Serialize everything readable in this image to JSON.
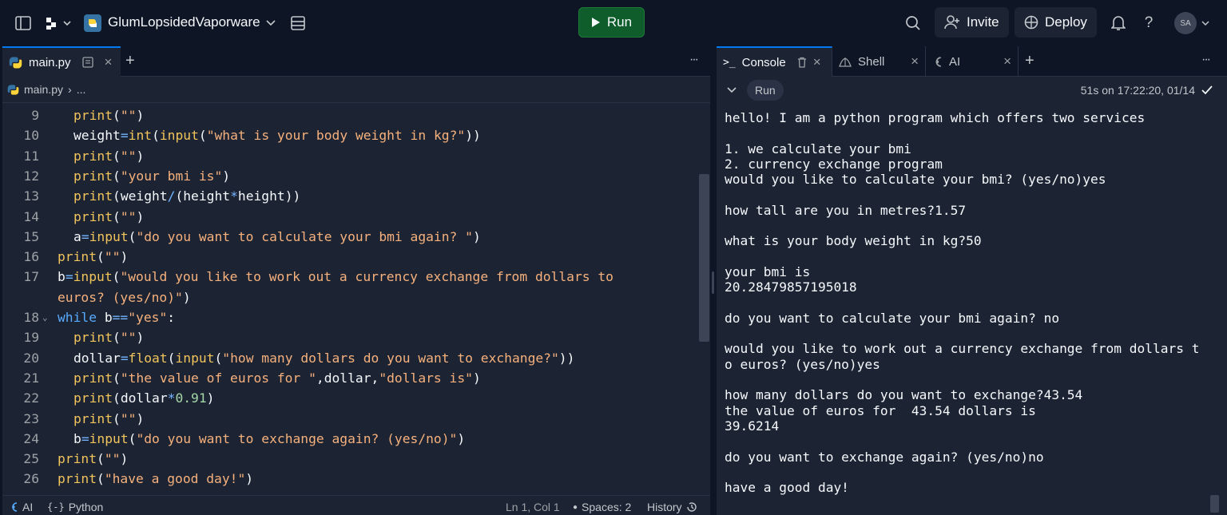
{
  "topbar": {
    "repl_name": "GlumLopsidedVaporware",
    "run_label": "Run",
    "invite_label": "Invite",
    "deploy_label": "Deploy",
    "help_label": "?",
    "avatar_initials": "SA",
    "icons": [
      "sidebar-toggle-icon",
      "workspace-icon",
      "python-icon",
      "chevron-down-icon",
      "database-icon",
      "search-icon",
      "add-user-icon",
      "deploy-icon",
      "bell-icon",
      "help-icon"
    ]
  },
  "editor": {
    "tab_label": "main.py",
    "tab_close": "×",
    "add_tab": "+",
    "more": "···",
    "breadcrumb_file": "main.py",
    "breadcrumb_sep": "›",
    "breadcrumb_more": "...",
    "lines": [
      {
        "n": "9",
        "indent": 1,
        "tokens": [
          [
            "kw",
            "print"
          ],
          [
            "txt",
            "("
          ],
          [
            "str",
            "\"\""
          ],
          [
            "txt",
            ")"
          ]
        ]
      },
      {
        "n": "10",
        "indent": 1,
        "tokens": [
          [
            "txt",
            "weight"
          ],
          [
            "op",
            "="
          ],
          [
            "kw",
            "int"
          ],
          [
            "txt",
            "("
          ],
          [
            "kw",
            "input"
          ],
          [
            "txt",
            "("
          ],
          [
            "str",
            "\"what is your body weight in kg?\""
          ],
          [
            "txt",
            "))"
          ]
        ]
      },
      {
        "n": "11",
        "indent": 1,
        "tokens": [
          [
            "kw",
            "print"
          ],
          [
            "txt",
            "("
          ],
          [
            "str",
            "\"\""
          ],
          [
            "txt",
            ")"
          ]
        ]
      },
      {
        "n": "12",
        "indent": 1,
        "tokens": [
          [
            "kw",
            "print"
          ],
          [
            "txt",
            "("
          ],
          [
            "str",
            "\"your bmi is\""
          ],
          [
            "txt",
            ")"
          ]
        ]
      },
      {
        "n": "13",
        "indent": 1,
        "tokens": [
          [
            "kw",
            "print"
          ],
          [
            "txt",
            "(weight"
          ],
          [
            "op",
            "/"
          ],
          [
            "txt",
            "(height"
          ],
          [
            "op",
            "*"
          ],
          [
            "txt",
            "height))"
          ]
        ]
      },
      {
        "n": "14",
        "indent": 1,
        "tokens": [
          [
            "kw",
            "print"
          ],
          [
            "txt",
            "("
          ],
          [
            "str",
            "\"\""
          ],
          [
            "txt",
            ")"
          ]
        ]
      },
      {
        "n": "15",
        "indent": 1,
        "tokens": [
          [
            "txt",
            "a"
          ],
          [
            "op",
            "="
          ],
          [
            "kw",
            "input"
          ],
          [
            "txt",
            "("
          ],
          [
            "str",
            "\"do you want to calculate your bmi again? \""
          ],
          [
            "txt",
            ")"
          ]
        ]
      },
      {
        "n": "16",
        "indent": 0,
        "tokens": [
          [
            "kw",
            "print"
          ],
          [
            "txt",
            "("
          ],
          [
            "str",
            "\"\""
          ],
          [
            "txt",
            ")"
          ]
        ]
      },
      {
        "n": "17",
        "indent": 0,
        "tokens": [
          [
            "txt",
            "b"
          ],
          [
            "op",
            "="
          ],
          [
            "kw",
            "input"
          ],
          [
            "txt",
            "("
          ],
          [
            "str",
            "\"would you like to work out a currency exchange from dollars to"
          ]
        ]
      },
      {
        "n": "",
        "indent": 0,
        "tokens": [
          [
            "str",
            "euros? (yes/no)\""
          ],
          [
            "txt",
            ")"
          ]
        ]
      },
      {
        "n": "18",
        "indent": 0,
        "fold": true,
        "tokens": [
          [
            "ctl",
            "while"
          ],
          [
            "txt",
            " b"
          ],
          [
            "op",
            "=="
          ],
          [
            "str",
            "\"yes\""
          ],
          [
            "txt",
            ":"
          ]
        ]
      },
      {
        "n": "19",
        "indent": 1,
        "tokens": [
          [
            "kw",
            "print"
          ],
          [
            "txt",
            "("
          ],
          [
            "str",
            "\"\""
          ],
          [
            "txt",
            ")"
          ]
        ]
      },
      {
        "n": "20",
        "indent": 1,
        "tokens": [
          [
            "txt",
            "dollar"
          ],
          [
            "op",
            "="
          ],
          [
            "kw",
            "float"
          ],
          [
            "txt",
            "("
          ],
          [
            "kw",
            "input"
          ],
          [
            "txt",
            "("
          ],
          [
            "str",
            "\"how many dollars do you want to exchange?\""
          ],
          [
            "txt",
            "))"
          ]
        ]
      },
      {
        "n": "21",
        "indent": 1,
        "tokens": [
          [
            "kw",
            "print"
          ],
          [
            "txt",
            "("
          ],
          [
            "str",
            "\"the value of euros for \""
          ],
          [
            "txt",
            ",dollar,"
          ],
          [
            "str",
            "\"dollars is\""
          ],
          [
            "txt",
            ")"
          ]
        ]
      },
      {
        "n": "22",
        "indent": 1,
        "tokens": [
          [
            "kw",
            "print"
          ],
          [
            "txt",
            "(dollar"
          ],
          [
            "op",
            "*"
          ],
          [
            "num",
            "0.91"
          ],
          [
            "txt",
            ")"
          ]
        ]
      },
      {
        "n": "23",
        "indent": 1,
        "tokens": [
          [
            "kw",
            "print"
          ],
          [
            "txt",
            "("
          ],
          [
            "str",
            "\"\""
          ],
          [
            "txt",
            ")"
          ]
        ]
      },
      {
        "n": "24",
        "indent": 1,
        "tokens": [
          [
            "txt",
            "b"
          ],
          [
            "op",
            "="
          ],
          [
            "kw",
            "input"
          ],
          [
            "txt",
            "("
          ],
          [
            "str",
            "\"do you want to exchange again? (yes/no)\""
          ],
          [
            "txt",
            ")"
          ]
        ]
      },
      {
        "n": "25",
        "indent": 0,
        "tokens": [
          [
            "kw",
            "print"
          ],
          [
            "txt",
            "("
          ],
          [
            "str",
            "\"\""
          ],
          [
            "txt",
            ")"
          ]
        ]
      },
      {
        "n": "26",
        "indent": 0,
        "tokens": [
          [
            "kw",
            "print"
          ],
          [
            "txt",
            "("
          ],
          [
            "str",
            "\"have a good day!\""
          ],
          [
            "txt",
            ")"
          ]
        ]
      }
    ],
    "status": {
      "ai": "AI",
      "language": "Python",
      "position": "Ln 1, Col 1",
      "spaces": "Spaces: 2",
      "history": "History"
    }
  },
  "console": {
    "tabs": [
      {
        "label": "Console",
        "icon": "terminal-icon",
        "active": true
      },
      {
        "label": "Shell",
        "icon": "shell-icon",
        "active": false
      },
      {
        "label": "AI",
        "icon": "ai-icon",
        "active": false
      }
    ],
    "add_tab": "+",
    "more": "···",
    "run_chip": "Run",
    "run_meta": "51s on 17:22:20, 01/14",
    "output": "hello! I am a python program which offers two services\n\n1. we calculate your bmi\n2. currency exchange program\nwould you like to calculate your bmi? (yes/no)yes\n\nhow tall are you in metres?1.57\n\nwhat is your body weight in kg?50\n\nyour bmi is\n20.28479857195018\n\ndo you want to calculate your bmi again? no\n\nwould you like to work out a currency exchange from dollars t\no euros? (yes/no)yes\n\nhow many dollars do you want to exchange?43.54\nthe value of euros for  43.54 dollars is\n39.6214\n\ndo you want to exchange again? (yes/no)no\n\nhave a good day!"
  },
  "colors": {
    "background": "#0e1525",
    "panel": "#1c2333",
    "run_green": "#0f5d2a",
    "accent_blue": "#0079f2",
    "keyword": "#f2c45c",
    "string": "#f6b17c",
    "number": "#a5d6a7",
    "operator": "#73b4ff"
  }
}
